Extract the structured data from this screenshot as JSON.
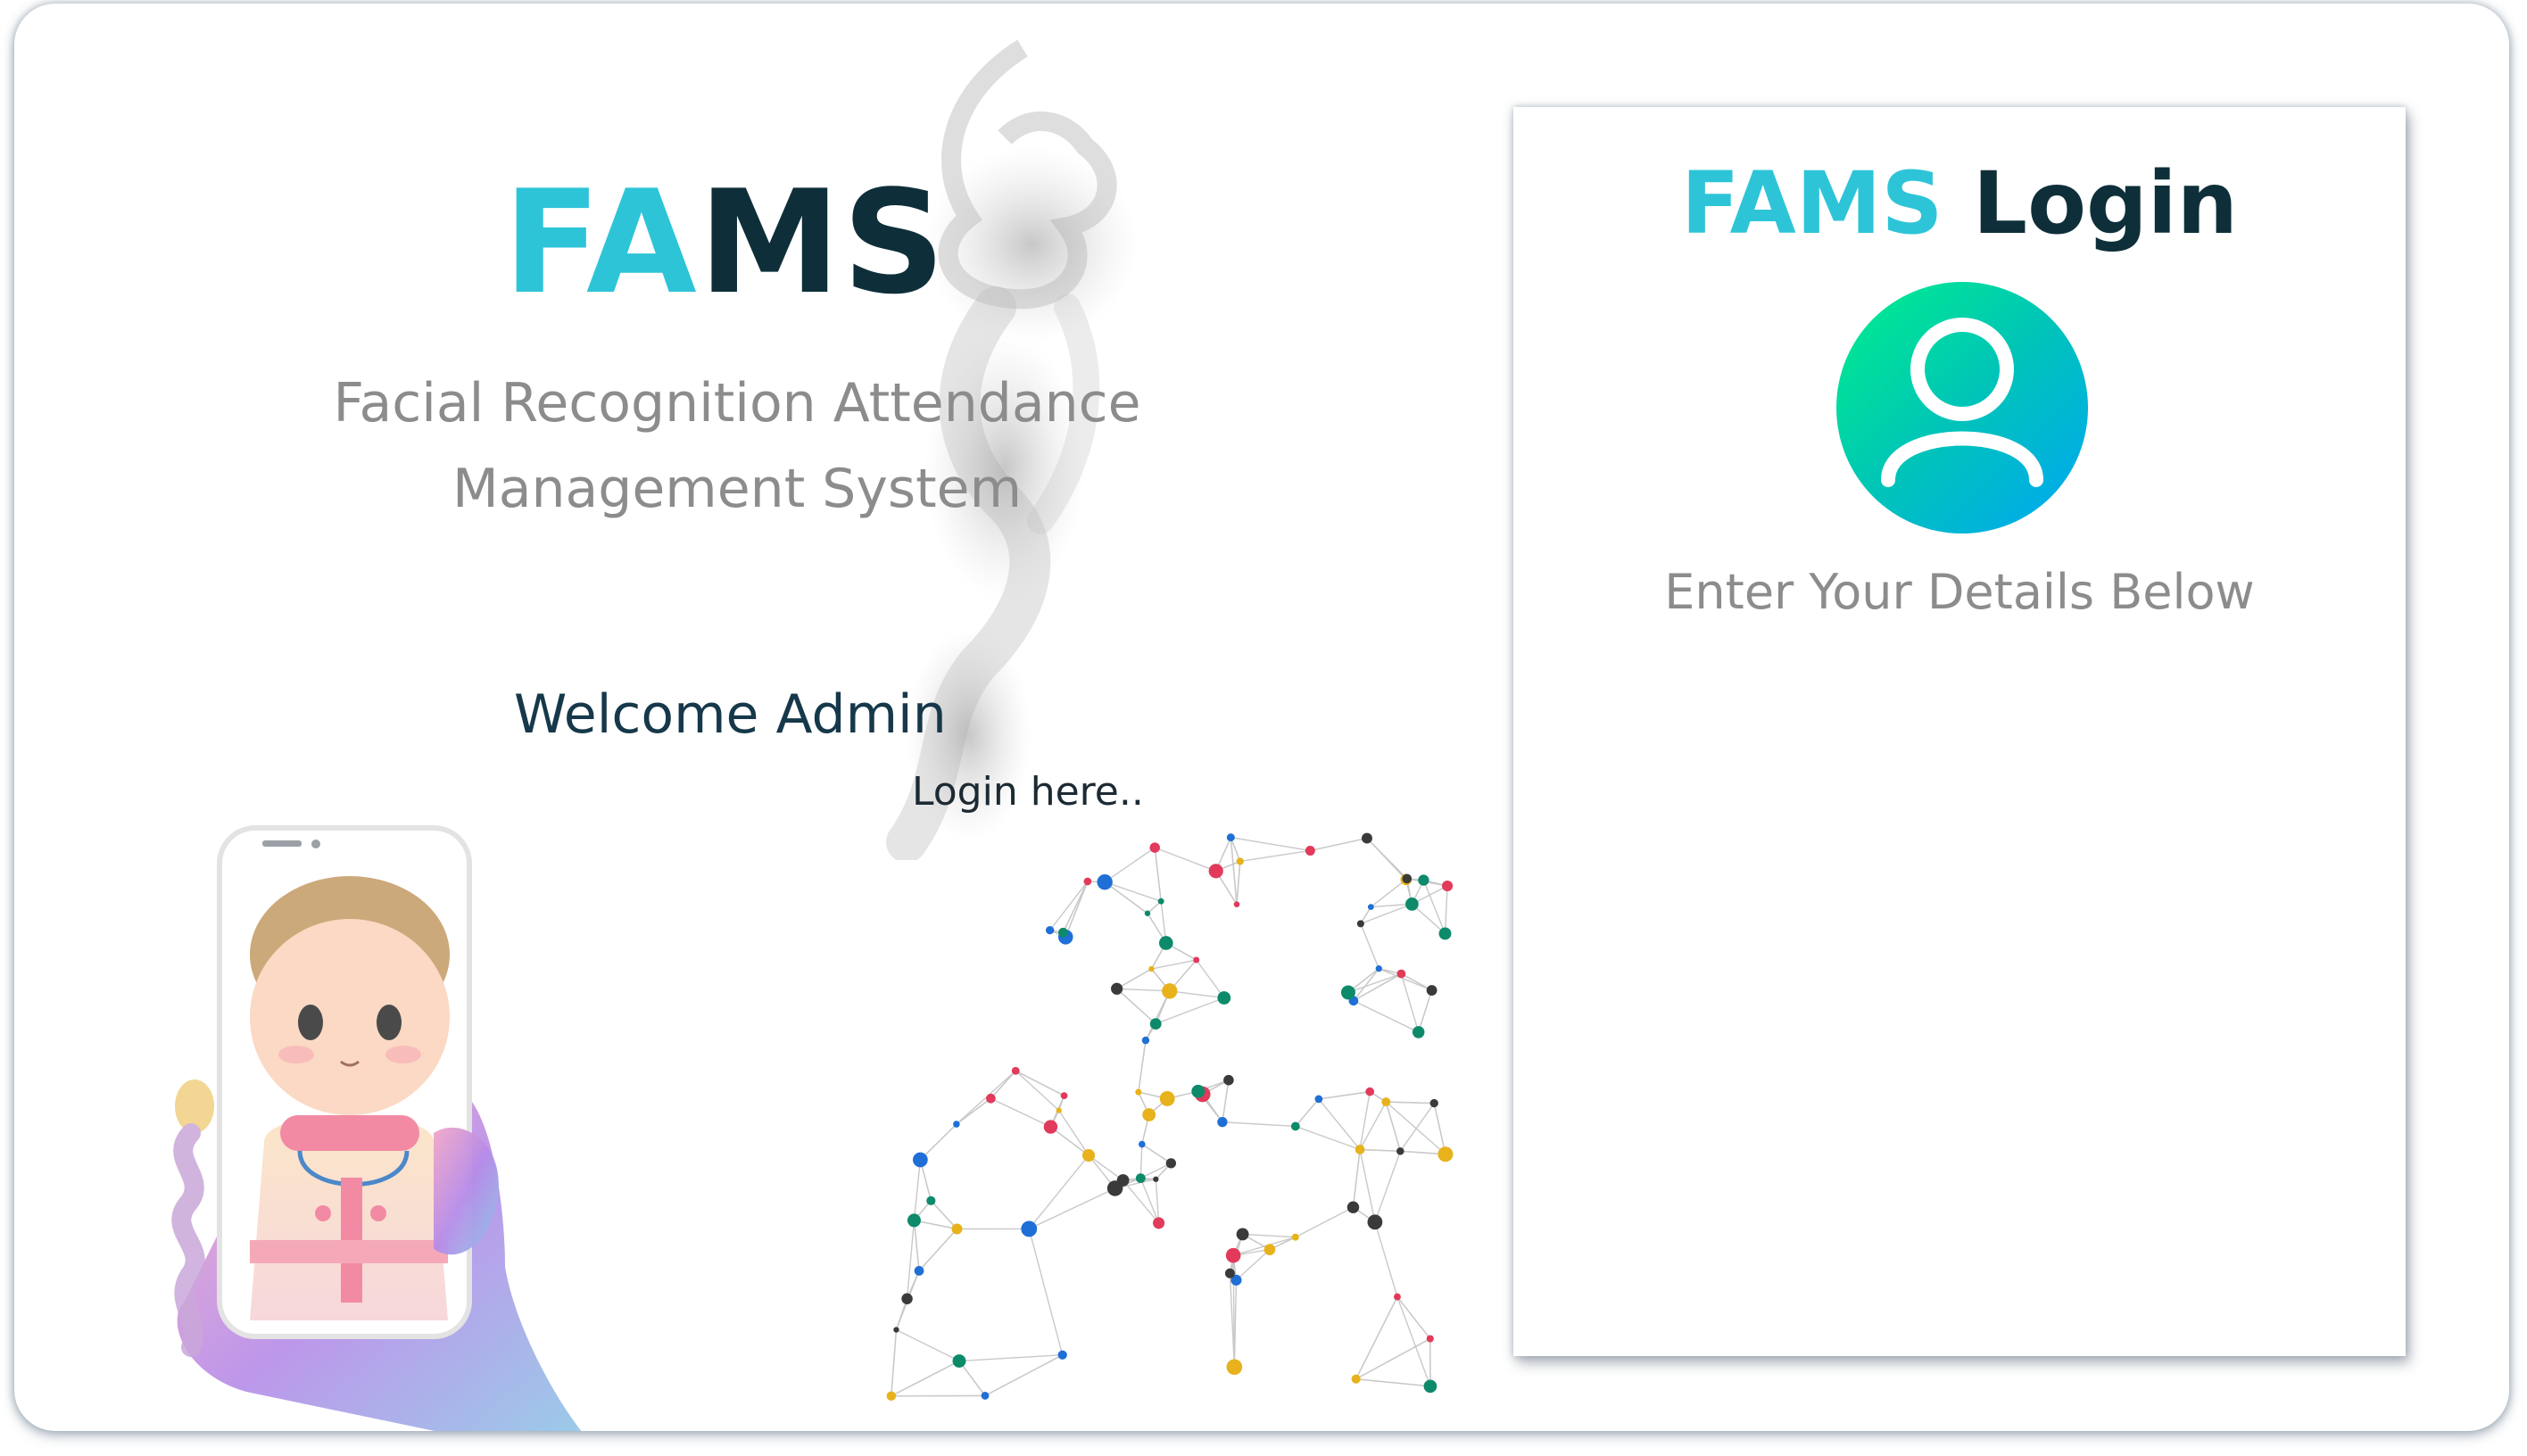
{
  "brand": {
    "part1": "FA",
    "part2": "MS",
    "subtitle_line1": "Facial Recognition Attendance",
    "subtitle_line2": "Management System"
  },
  "welcome": {
    "heading": "Welcome Admin",
    "login_hint": "Login here.."
  },
  "login_card": {
    "title_part1": "FAMS",
    "title_part2": "Login",
    "avatar_icon": "user-icon",
    "instruction": "Enter Your Details Below"
  },
  "colors": {
    "brand_accent": "#2ec4d8",
    "brand_dark": "#0e2f3a",
    "muted_text": "#8c8c8c",
    "avatar_gradient_start": "#00f08a",
    "avatar_gradient_end": "#00a6f5"
  }
}
